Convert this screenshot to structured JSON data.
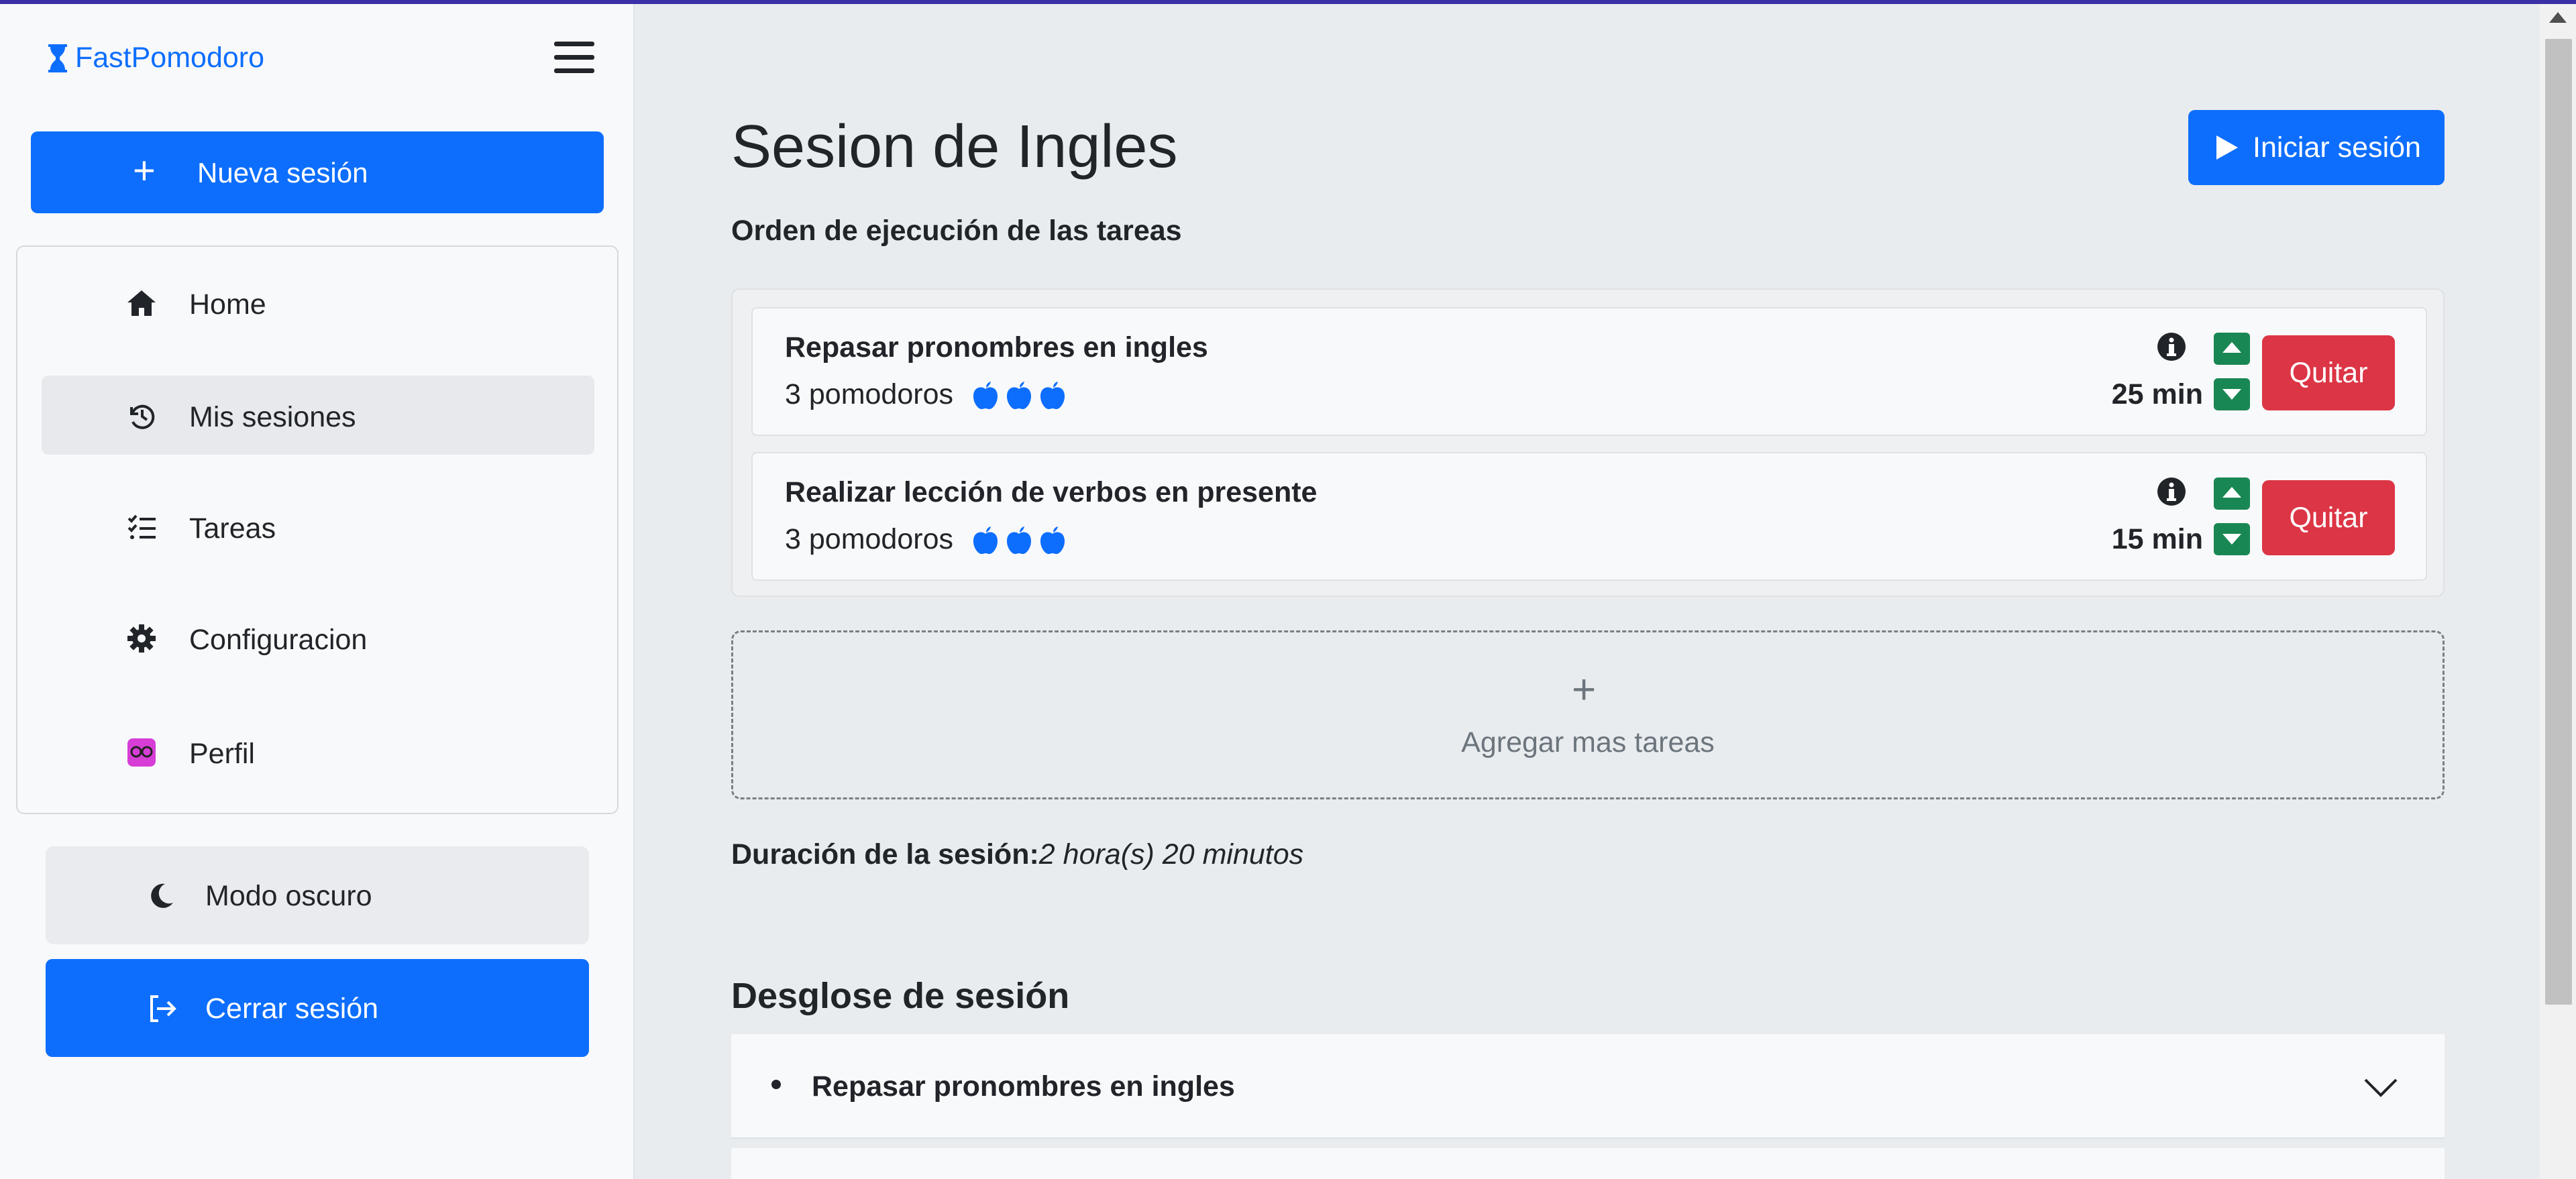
{
  "app": {
    "brand": "FastPomodoro",
    "accent_color": "#0d6efd"
  },
  "sidebar": {
    "new_session_label": "Nueva sesión",
    "nav": [
      {
        "label": "Home",
        "icon": "home-icon"
      },
      {
        "label": "Mis sesiones",
        "icon": "history-icon",
        "active": true
      },
      {
        "label": "Tareas",
        "icon": "list-check-icon"
      },
      {
        "label": "Configuracion",
        "icon": "gear-icon"
      },
      {
        "label": "Perfil",
        "icon": "avatar-icon"
      }
    ],
    "dark_mode_label": "Modo oscuro",
    "logout_label": "Cerrar sesión"
  },
  "main": {
    "title": "Sesion de Ingles",
    "start_label": "Iniciar sesión",
    "order_label": "Orden de ejecución de las tareas",
    "tasks": [
      {
        "name": "Repasar pronombres en ingles",
        "pomodoros": "3 pomodoros",
        "pomodoro_count": 3,
        "duration": "25 min",
        "remove_label": "Quitar"
      },
      {
        "name": "Realizar lección de verbos en presente",
        "pomodoros": "3 pomodoros",
        "pomodoro_count": 3,
        "duration": "15 min",
        "remove_label": "Quitar"
      }
    ],
    "add_plus": "+",
    "add_label": "Agregar mas tareas",
    "duration_label": "Duración de la sesión:",
    "duration_value": "2 hora(s) 20 minutos",
    "breakdown_title": "Desglose de sesión",
    "breakdown_items": [
      {
        "label": "Repasar pronombres en ingles"
      }
    ]
  },
  "colors": {
    "primary": "#0d6efd",
    "danger": "#dc3545",
    "success": "#198754"
  }
}
